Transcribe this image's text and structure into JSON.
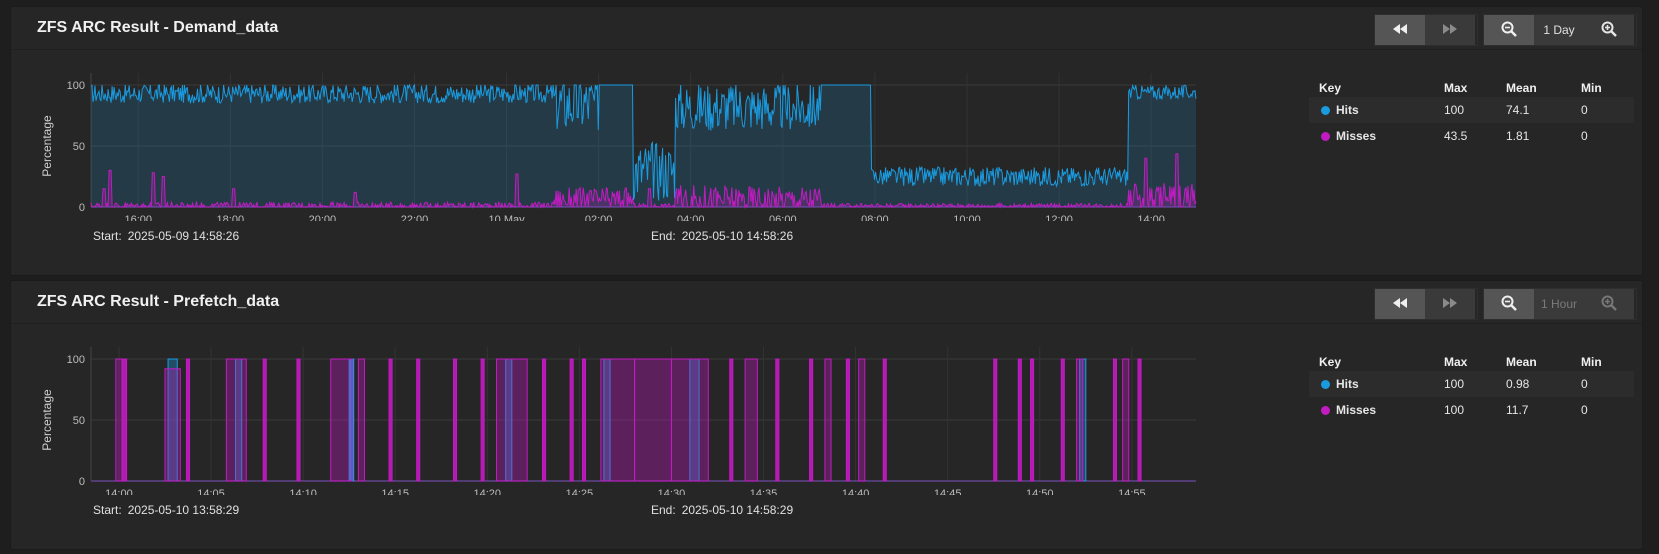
{
  "charts": [
    {
      "title": "ZFS ARC Result - Demand_data",
      "range_label": "1 Day",
      "range_disabled": false,
      "start_label": "Start:",
      "start": "2025-05-09 14:58:26",
      "end_label": "End:",
      "end": "2025-05-10 14:58:26",
      "ylabel": "Percentage",
      "legend_headers": {
        "key": "Key",
        "max": "Max",
        "mean": "Mean",
        "min": "Min"
      },
      "legend": [
        {
          "name": "Hits",
          "max": "100",
          "mean": "74.1",
          "min": "0",
          "color": "#1a9be0"
        },
        {
          "name": "Misses",
          "max": "43.5",
          "mean": "1.81",
          "min": "0",
          "color": "#c21bc2"
        }
      ]
    },
    {
      "title": "ZFS ARC Result - Prefetch_data",
      "range_label": "1 Hour",
      "range_disabled": true,
      "start_label": "Start:",
      "start": "2025-05-10 13:58:29",
      "end_label": "End:",
      "end": "2025-05-10 14:58:29",
      "ylabel": "Percentage",
      "legend_headers": {
        "key": "Key",
        "max": "Max",
        "mean": "Mean",
        "min": "Min"
      },
      "legend": [
        {
          "name": "Hits",
          "max": "100",
          "mean": "0.98",
          "min": "0",
          "color": "#1a9be0"
        },
        {
          "name": "Misses",
          "max": "100",
          "mean": "11.7",
          "min": "0",
          "color": "#c21bc2"
        }
      ]
    }
  ],
  "icons": {
    "rewind": "rewind-icon",
    "fast_forward": "fast-forward-icon",
    "zoom_out": "zoom-out-icon",
    "zoom_in": "zoom-in-icon"
  },
  "chart_data": [
    {
      "type": "area",
      "ylabel": "Percentage",
      "ylim": [
        0,
        100
      ],
      "yticks": [
        "0",
        "50",
        "100"
      ],
      "xlim": [
        "2025-05-09 14:58:26",
        "2025-05-10 14:58:26"
      ],
      "xticks": [
        "16:00",
        "18:00",
        "20:00",
        "22:00",
        "10 May",
        "02:00",
        "04:00",
        "06:00",
        "08:00",
        "10:00",
        "12:00",
        "14:00"
      ],
      "grid": true,
      "series": [
        {
          "name": "Hits",
          "color": "#1a9be0",
          "segments": [
            {
              "from": "2025-05-09 14:58:26",
              "to": "2025-05-10 01:00",
              "level": 93,
              "noise": 8
            },
            {
              "from": "2025-05-10 01:00",
              "to": "2025-05-10 02:00",
              "level": 85,
              "noise": 25
            },
            {
              "from": "2025-05-10 02:00",
              "to": "2025-05-10 02:45",
              "level": 100,
              "noise": 0
            },
            {
              "from": "2025-05-10 02:45",
              "to": "2025-05-10 03:40",
              "level": 30,
              "noise": 25
            },
            {
              "from": "2025-05-10 03:40",
              "to": "2025-05-10 06:50",
              "level": 82,
              "noise": 20
            },
            {
              "from": "2025-05-10 06:50",
              "to": "2025-05-10 07:55",
              "level": 100,
              "noise": 0
            },
            {
              "from": "2025-05-10 07:55",
              "to": "2025-05-10 13:30",
              "level": 25,
              "noise": 8
            },
            {
              "from": "2025-05-10 13:30",
              "to": "2025-05-10 14:58:26",
              "level": 94,
              "noise": 6
            }
          ]
        },
        {
          "name": "Misses",
          "color": "#c21bc2",
          "segments": [
            {
              "from": "2025-05-09 14:58:26",
              "to": "2025-05-10 01:00",
              "level": 1,
              "noise": 3
            },
            {
              "from": "2025-05-10 01:00",
              "to": "2025-05-10 02:45",
              "level": 6,
              "noise": 10
            },
            {
              "from": "2025-05-10 02:45",
              "to": "2025-05-10 03:40",
              "level": 1,
              "noise": 2
            },
            {
              "from": "2025-05-10 03:40",
              "to": "2025-05-10 06:50",
              "level": 6,
              "noise": 12
            },
            {
              "from": "2025-05-10 06:50",
              "to": "2025-05-10 13:30",
              "level": 1,
              "noise": 2
            },
            {
              "from": "2025-05-10 13:30",
              "to": "2025-05-10 14:58:26",
              "level": 8,
              "noise": 12
            }
          ],
          "peaks": [
            {
              "time": "2025-05-09 15:16",
              "value": 15
            },
            {
              "time": "2025-05-09 15:23",
              "value": 30
            },
            {
              "time": "2025-05-09 16:19",
              "value": 28
            },
            {
              "time": "2025-05-09 16:33",
              "value": 25
            },
            {
              "time": "2025-05-09 18:04",
              "value": 15
            },
            {
              "time": "2025-05-09 20:43",
              "value": 12
            },
            {
              "time": "2025-05-10 00:13",
              "value": 27
            },
            {
              "time": "2025-05-10 03:06",
              "value": 15
            },
            {
              "time": "2025-05-10 13:53",
              "value": 40
            },
            {
              "time": "2025-05-10 14:33",
              "value": 43.5
            }
          ]
        }
      ]
    },
    {
      "type": "area",
      "ylabel": "Percentage",
      "ylim": [
        0,
        100
      ],
      "yticks": [
        "0",
        "50",
        "100"
      ],
      "xlim": [
        "2025-05-10 13:58:29",
        "2025-05-10 14:58:29"
      ],
      "xticks": [
        "14:00",
        "14:05",
        "14:10",
        "14:15",
        "14:20",
        "14:25",
        "14:30",
        "14:35",
        "14:40",
        "14:45",
        "14:50",
        "14:55"
      ],
      "grid": true,
      "series": [
        {
          "name": "Hits",
          "color": "#1a9be0",
          "spikes": [
            {
              "from": "2025-05-10 14:02:40",
              "to": "2025-05-10 14:03:10",
              "value": 100
            },
            {
              "from": "2025-05-10 14:06:20",
              "to": "2025-05-10 14:06:40",
              "value": 100
            },
            {
              "from": "2025-05-10 14:12:30",
              "to": "2025-05-10 14:12:45",
              "value": 100
            },
            {
              "from": "2025-05-10 14:21:00",
              "to": "2025-05-10 14:21:20",
              "value": 100
            },
            {
              "from": "2025-05-10 14:26:20",
              "to": "2025-05-10 14:26:40",
              "value": 100
            },
            {
              "from": "2025-05-10 14:31:00",
              "to": "2025-05-10 14:31:30",
              "value": 100
            },
            {
              "from": "2025-05-10 14:52:10",
              "to": "2025-05-10 14:52:30",
              "value": 100
            }
          ]
        },
        {
          "name": "Misses",
          "color": "#c21bc2",
          "spikes": [
            {
              "from": "2025-05-10 13:59:50",
              "to": "2025-05-10 14:00:10",
              "value": 100
            },
            {
              "from": "2025-05-10 14:00:10",
              "to": "2025-05-10 14:00:25",
              "value": 100
            },
            {
              "from": "2025-05-10 14:02:30",
              "to": "2025-05-10 14:03:20",
              "value": 92
            },
            {
              "from": "2025-05-10 14:03:40",
              "to": "2025-05-10 14:03:50",
              "value": 100
            },
            {
              "from": "2025-05-10 14:05:50",
              "to": "2025-05-10 14:06:55",
              "value": 100
            },
            {
              "from": "2025-05-10 14:07:50",
              "to": "2025-05-10 14:08:00",
              "value": 100
            },
            {
              "from": "2025-05-10 14:09:40",
              "to": "2025-05-10 14:09:50",
              "value": 100
            },
            {
              "from": "2025-05-10 14:11:30",
              "to": "2025-05-10 14:12:40",
              "value": 100
            },
            {
              "from": "2025-05-10 14:13:00",
              "to": "2025-05-10 14:13:20",
              "value": 100
            },
            {
              "from": "2025-05-10 14:14:40",
              "to": "2025-05-10 14:14:50",
              "value": 100
            },
            {
              "from": "2025-05-10 14:16:10",
              "to": "2025-05-10 14:16:20",
              "value": 100
            },
            {
              "from": "2025-05-10 14:18:10",
              "to": "2025-05-10 14:18:20",
              "value": 100
            },
            {
              "from": "2025-05-10 14:19:40",
              "to": "2025-05-10 14:19:50",
              "value": 100
            },
            {
              "from": "2025-05-10 14:20:30",
              "to": "2025-05-10 14:22:10",
              "value": 100
            },
            {
              "from": "2025-05-10 14:23:00",
              "to": "2025-05-10 14:23:10",
              "value": 100
            },
            {
              "from": "2025-05-10 14:24:30",
              "to": "2025-05-10 14:24:40",
              "value": 100
            },
            {
              "from": "2025-05-10 14:25:10",
              "to": "2025-05-10 14:25:20",
              "value": 100
            },
            {
              "from": "2025-05-10 14:26:10",
              "to": "2025-05-10 14:28:00",
              "value": 100
            },
            {
              "from": "2025-05-10 14:28:00",
              "to": "2025-05-10 14:30:00",
              "value": 100
            },
            {
              "from": "2025-05-10 14:30:00",
              "to": "2025-05-10 14:32:00",
              "value": 100
            },
            {
              "from": "2025-05-10 14:33:10",
              "to": "2025-05-10 14:33:20",
              "value": 100
            },
            {
              "from": "2025-05-10 14:34:00",
              "to": "2025-05-10 14:34:40",
              "value": 100
            },
            {
              "from": "2025-05-10 14:35:40",
              "to": "2025-05-10 14:35:50",
              "value": 100
            },
            {
              "from": "2025-05-10 14:37:30",
              "to": "2025-05-10 14:37:40",
              "value": 100
            },
            {
              "from": "2025-05-10 14:38:20",
              "to": "2025-05-10 14:38:40",
              "value": 100
            },
            {
              "from": "2025-05-10 14:39:30",
              "to": "2025-05-10 14:39:40",
              "value": 100
            },
            {
              "from": "2025-05-10 14:40:10",
              "to": "2025-05-10 14:40:30",
              "value": 100
            },
            {
              "from": "2025-05-10 14:41:30",
              "to": "2025-05-10 14:41:40",
              "value": 100
            },
            {
              "from": "2025-05-10 14:47:30",
              "to": "2025-05-10 14:47:40",
              "value": 100
            },
            {
              "from": "2025-05-10 14:48:50",
              "to": "2025-05-10 14:49:00",
              "value": 100
            },
            {
              "from": "2025-05-10 14:49:30",
              "to": "2025-05-10 14:49:40",
              "value": 100
            },
            {
              "from": "2025-05-10 14:51:10",
              "to": "2025-05-10 14:51:20",
              "value": 100
            },
            {
              "from": "2025-05-10 14:52:00",
              "to": "2025-05-10 14:52:20",
              "value": 100
            },
            {
              "from": "2025-05-10 14:54:00",
              "to": "2025-05-10 14:54:10",
              "value": 100
            },
            {
              "from": "2025-05-10 14:54:30",
              "to": "2025-05-10 14:54:50",
              "value": 100
            },
            {
              "from": "2025-05-10 14:55:20",
              "to": "2025-05-10 14:55:30",
              "value": 100
            }
          ]
        }
      ]
    }
  ]
}
